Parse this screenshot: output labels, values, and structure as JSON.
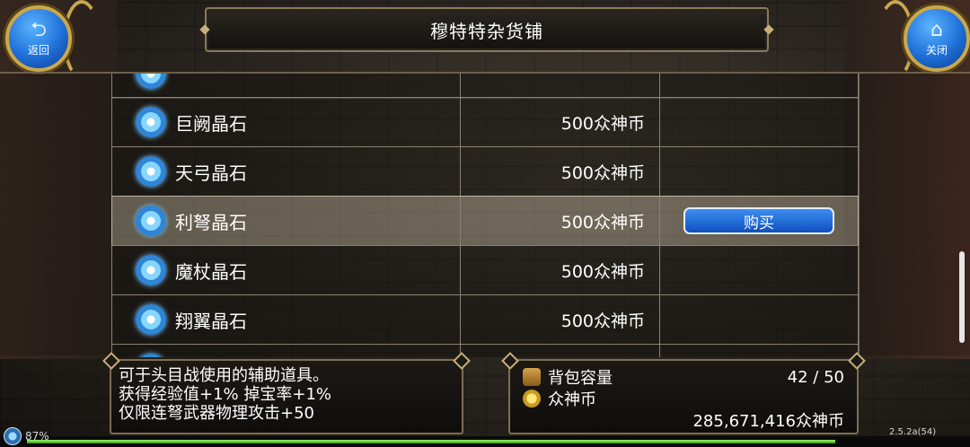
{
  "header": {
    "title": "穆特特杂货铺",
    "back_label": "返回",
    "close_label": "关闭",
    "back_icon": "back-arrow-icon",
    "close_icon": "home-icon"
  },
  "shop": {
    "items": [
      {
        "name": "",
        "price": "",
        "buy_label": ""
      },
      {
        "name": "巨阙晶石",
        "price": "500众神币",
        "buy_label": ""
      },
      {
        "name": "天弓晶石",
        "price": "500众神币",
        "buy_label": ""
      },
      {
        "name": "利弩晶石",
        "price": "500众神币",
        "buy_label": "购买"
      },
      {
        "name": "魔杖晶石",
        "price": "500众神币",
        "buy_label": ""
      },
      {
        "name": "翔翼晶石",
        "price": "500众神币",
        "buy_label": ""
      }
    ],
    "item_icon": "crystal-gem-icon",
    "selected_index": 3
  },
  "description": {
    "lines": [
      "可于头目战使用的辅助道具。",
      "获得经验值+1% 掉宝率+1%",
      "仅限连弩武器物理攻击+50"
    ]
  },
  "inventory": {
    "bag_label": "背包容量",
    "bag_value": "42 / 50",
    "currency_label": "众神币",
    "currency_value": "285,671,416众神币"
  },
  "status": {
    "battery": "87%",
    "version": "2.5.2a(54)"
  }
}
